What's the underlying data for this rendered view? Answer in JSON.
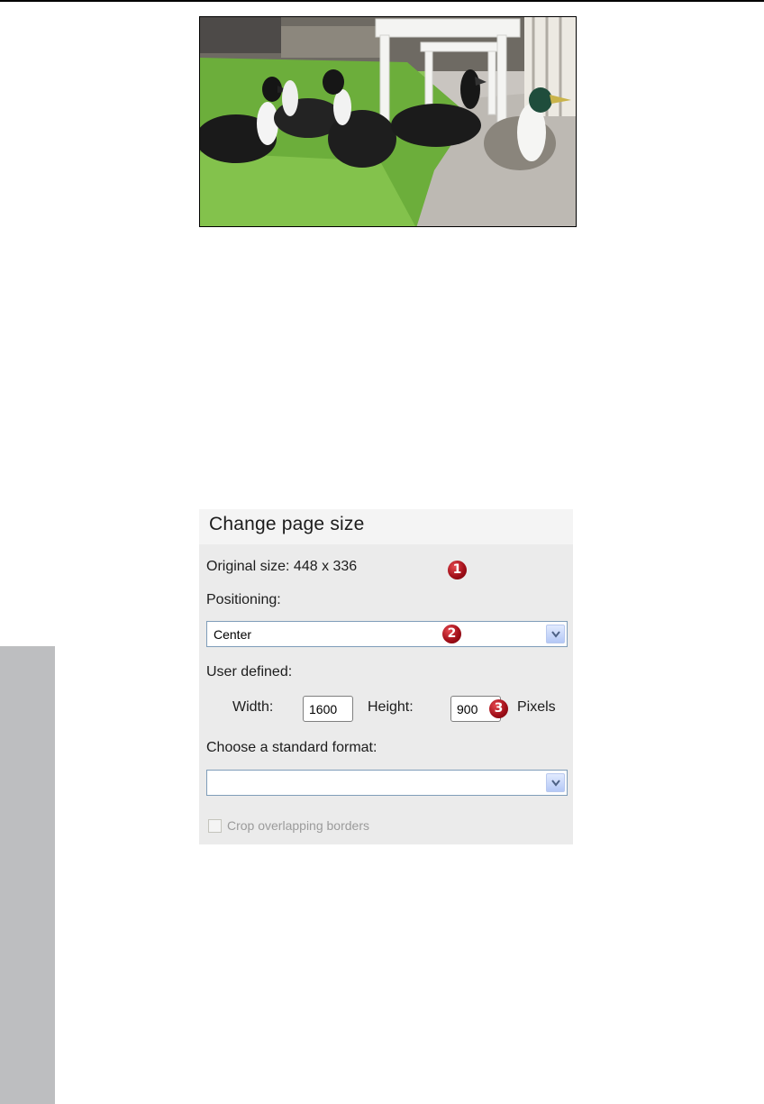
{
  "figure": {
    "photo_alt": "ducks-on-grass-photo"
  },
  "dialog": {
    "title": "Change page size",
    "original_size_label": "Original size: 448 x 336",
    "positioning_label": "Positioning:",
    "positioning_value": "Center",
    "user_defined_label": "User defined:",
    "width_label": "Width:",
    "width_value": "1600",
    "height_label": "Height:",
    "height_value": "900",
    "units_label": "Pixels",
    "standard_format_label": "Choose a standard format:",
    "standard_format_value": "",
    "crop_label": "Crop overlapping borders",
    "crop_checked": false,
    "crop_enabled": false
  },
  "callouts": [
    "1",
    "2",
    "3"
  ],
  "colors": {
    "dialog_bg": "#ebebeb",
    "badge_red": "#a3101a",
    "side_tab": "#bdbec0"
  }
}
